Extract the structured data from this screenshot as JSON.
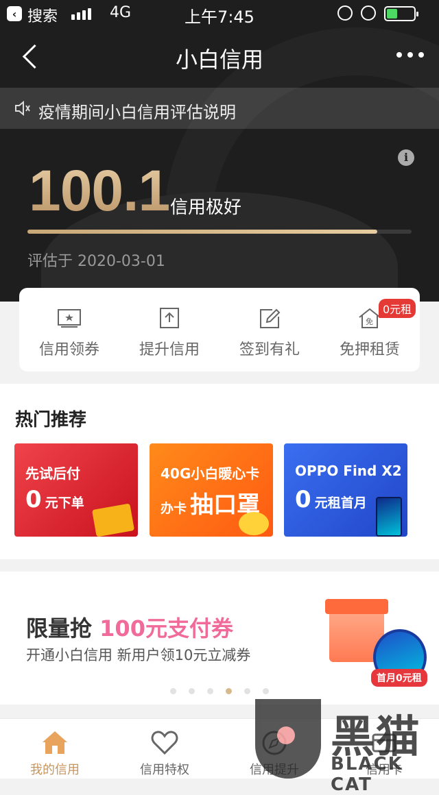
{
  "status_bar": {
    "back_app": "搜索",
    "network": "4G",
    "time": "上午7:45",
    "battery_level": 0.4
  },
  "nav": {
    "title": "小白信用"
  },
  "notice": {
    "text": "疫情期间小白信用评估说明"
  },
  "score": {
    "value": "100.1",
    "level": "信用极好",
    "progress": 0.91,
    "evaluated": "评估于 2020-03-01"
  },
  "actions": [
    {
      "label": "信用领券",
      "icon": "coupon-icon"
    },
    {
      "label": "提升信用",
      "icon": "upload-icon"
    },
    {
      "label": "签到有礼",
      "icon": "edit-icon"
    },
    {
      "label": "免押租赁",
      "icon": "house-icon",
      "badge": "0元租"
    }
  ],
  "hot": {
    "title": "热门推荐",
    "items": [
      {
        "line1": "先试后付",
        "big": "0",
        "small": "元下单"
      },
      {
        "line1": "40G小白暖心卡",
        "small": "办卡",
        "big": "抽口罩"
      },
      {
        "line1": "OPPO Find X2",
        "big": "0",
        "small": "元租首月"
      }
    ]
  },
  "banner": {
    "title_prefix": "限量抢 ",
    "title_highlight": "100元支付券",
    "subtitle": "开通小白信用 新用户领10元立减券",
    "tag": "首月0元租",
    "dot_count": 6,
    "active_dot": 3
  },
  "tabs": [
    {
      "label": "我的信用",
      "icon": "home-icon",
      "active": true
    },
    {
      "label": "信用特权",
      "icon": "heart-icon",
      "active": false
    },
    {
      "label": "信用提升",
      "icon": "compass-icon",
      "active": false
    },
    {
      "label": "信用卡",
      "icon": "card-icon",
      "active": false
    }
  ],
  "watermark": {
    "cn": "黑猫",
    "en": "BLACK CAT"
  },
  "colors": {
    "dark_bg": "#1e1e1e",
    "gold": "#d8b98c",
    "active_tab": "#c8955a",
    "badge_red": "#e53935",
    "highlight_pink": "#f06b9a"
  }
}
